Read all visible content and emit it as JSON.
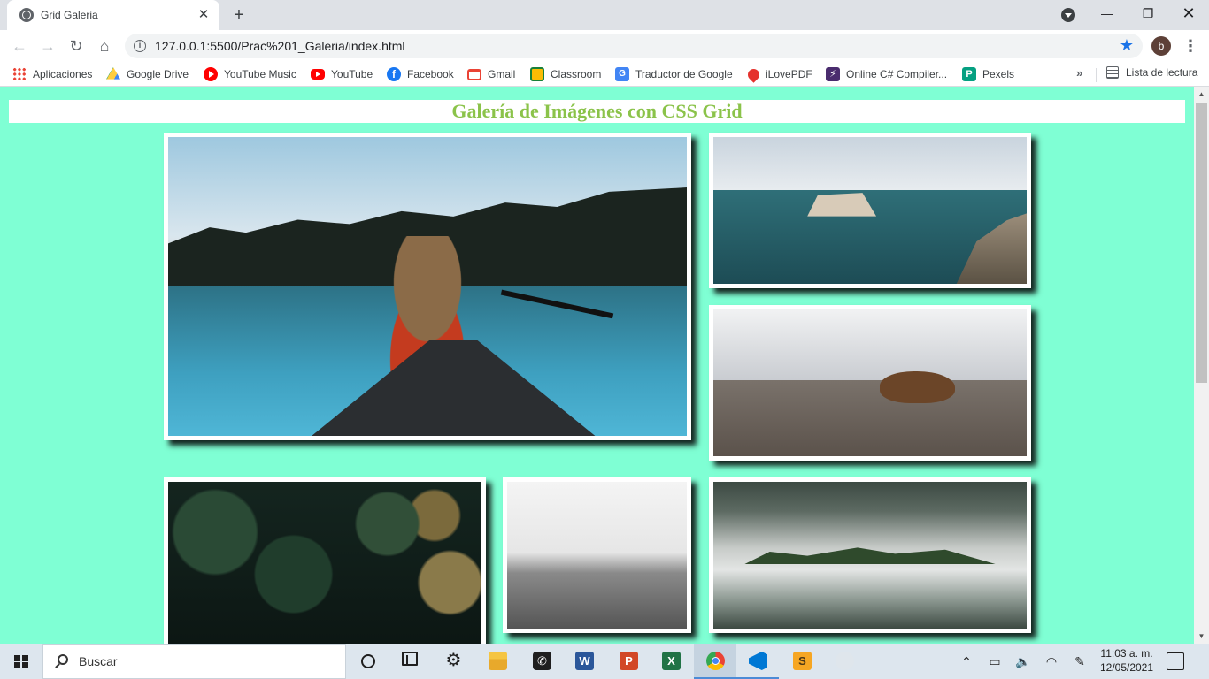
{
  "browser": {
    "tab_title": "Grid Galeria",
    "tab_close": "✕",
    "new_tab": "+",
    "window_controls": {
      "minimize": "—",
      "maximize": "❐",
      "close": "✕"
    },
    "nav": {
      "back": "←",
      "forward": "→",
      "reload": "↻",
      "home": "⌂"
    },
    "url": "127.0.0.1:5500/Prac%201_Galeria/index.html",
    "info_symbol": "i",
    "star_symbol": "★",
    "profile_initial": "b",
    "menu_symbol": "⋮"
  },
  "bookmarks": {
    "items": [
      {
        "label": "Aplicaciones",
        "icon": "apps-grid-icon"
      },
      {
        "label": "Google Drive",
        "icon": "google-drive-icon"
      },
      {
        "label": "YouTube Music",
        "icon": "youtube-music-icon"
      },
      {
        "label": "YouTube",
        "icon": "youtube-icon"
      },
      {
        "label": "Facebook",
        "icon": "facebook-icon",
        "glyph": "f"
      },
      {
        "label": "Gmail",
        "icon": "gmail-icon"
      },
      {
        "label": "Classroom",
        "icon": "classroom-icon"
      },
      {
        "label": "Traductor de Google",
        "icon": "google-translate-icon",
        "glyph": "G"
      },
      {
        "label": "iLovePDF",
        "icon": "ilovepdf-icon"
      },
      {
        "label": "Online C# Compiler...",
        "icon": "csharp-compiler-icon",
        "glyph": "⚡"
      },
      {
        "label": "Pexels",
        "icon": "pexels-icon",
        "glyph": "P"
      }
    ],
    "overflow": "»",
    "reading_list": "Lista de lectura"
  },
  "page": {
    "title": "Galería de Imágenes con CSS Grid",
    "title_color": "#8bc34a",
    "background_color": "#7fffd4"
  },
  "taskbar": {
    "search_placeholder": "Buscar",
    "apps": [
      {
        "name": "cortana",
        "icon": "cortana-icon"
      },
      {
        "name": "task-view",
        "icon": "task-view-icon"
      },
      {
        "name": "settings",
        "icon": "settings-gear-icon",
        "glyph": "⚙"
      },
      {
        "name": "file-explorer",
        "icon": "file-explorer-icon"
      },
      {
        "name": "whatsapp",
        "icon": "whatsapp-icon",
        "glyph": "✆"
      },
      {
        "name": "word",
        "icon": "word-icon",
        "glyph": "W"
      },
      {
        "name": "powerpoint",
        "icon": "powerpoint-icon",
        "glyph": "P"
      },
      {
        "name": "excel",
        "icon": "excel-icon",
        "glyph": "X"
      },
      {
        "name": "chrome",
        "icon": "chrome-icon"
      },
      {
        "name": "vscode",
        "icon": "vscode-icon"
      },
      {
        "name": "sublime-text",
        "icon": "sublime-icon",
        "glyph": "S"
      },
      {
        "name": "pinned-app",
        "icon": "faded-app-icon"
      }
    ],
    "tray": {
      "chevron": "⌃",
      "battery": "▭",
      "volume": "🔈",
      "wifi": "◠",
      "pen": "✎"
    },
    "time": "11:03 a. m.",
    "date": "12/05/2021"
  }
}
